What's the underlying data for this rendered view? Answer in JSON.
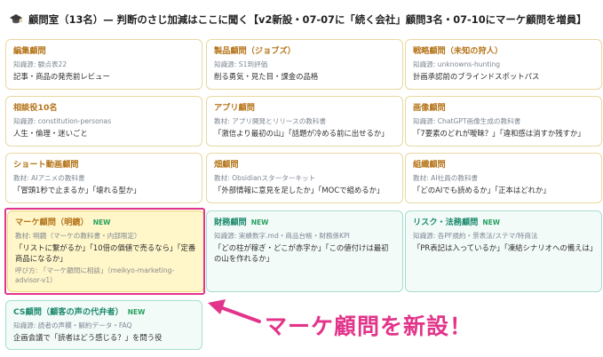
{
  "header": {
    "icon": "graduation-cap-icon",
    "title": "顧問室（13名）— 判断のさじ加減はここに聞く【v2新設・07-07に「続く会社」顧問3名・07-10にマーケ顧問を増員】"
  },
  "cards": [
    {
      "name": "編集顧問",
      "meta": "知識源: 観点表22",
      "role": "記事・商品の発売前レビュー"
    },
    {
      "name": "製品顧問（ジョブズ）",
      "meta": "知識源: S1到評価",
      "role": "削る勇気・見た目・課金の品格"
    },
    {
      "name": "戦略顧問（未知の狩人）",
      "meta": "知識源: unknowns-hunting",
      "role": "計画承認前のブラインドスポットパス"
    },
    {
      "name": "相談役10名",
      "meta": "知識源: constitution-personas",
      "role": "人生・倫理・迷いごと"
    },
    {
      "name": "アプリ顧問",
      "meta": "教材: アプリ開発とリリースの教科書",
      "role": "「激信より最初の山」「話題が冷める前に出せるか」"
    },
    {
      "name": "画像顧問",
      "meta": "知識源: ChatGPT画像生成の教科書",
      "role": "「7要素のどれが曖昧？」「違和感は消すか残すか」"
    },
    {
      "name": "ショート動画顧問",
      "meta": "教材: AIアニメの教科書",
      "role": "「冒頭1秒で止まるか」「壊れる型か」"
    },
    {
      "name": "畑顧問",
      "meta": "教材: Obsidianスターターキット",
      "role": "「外部情報に意見を足したか」「MOCで組めるか」"
    },
    {
      "name": "組織顧問",
      "meta": "教材: AI社員の教科書",
      "role": "「どのAIでも読めるか」「正本はどれか」"
    },
    {
      "name": "マーケ顧問（明鏡）",
      "badge": "NEW",
      "meta": "教材: 明鏡（マーケの教科書・内部限定）",
      "role": "「リストに繋がるか」「10倍の価値で売るなら」「定番商品になるか」",
      "call": "呼び方: 「マーケ顧問に相談」（meikyo-marketing-advisor-v1）"
    },
    {
      "name": "財務顧問",
      "badge": "NEW",
      "meta": "知識源: 実績数字.md・商品台帳・財務係KPI",
      "role": "「どの柱が稼ぎ・どこが赤字か」「この値付けは最初の山を作れるか」"
    },
    {
      "name": "リスク・法務顧問",
      "badge": "NEW",
      "meta": "知識源: 各PF規約・景表法/ステマ/特商法",
      "role": "「PR表記は入っているか」「凍結シナリオへの備えは」"
    },
    {
      "name": "CS顧問（顧客の声の代弁者）",
      "badge": "NEW",
      "meta": "知識源: 読者の声欄・解約データ・FAQ",
      "role": "企画会議で「読者はどう感じる？」を問う役"
    }
  ],
  "callout": {
    "text": "マーケ顧問を新設！"
  },
  "colors": {
    "card_border": "#e8d9a0",
    "card_green_border": "#a6ddd0",
    "title_orange": "#b5751a",
    "title_green": "#1d8a6e",
    "accent_pink": "#e2348a",
    "new_badge": "#27a15f"
  }
}
